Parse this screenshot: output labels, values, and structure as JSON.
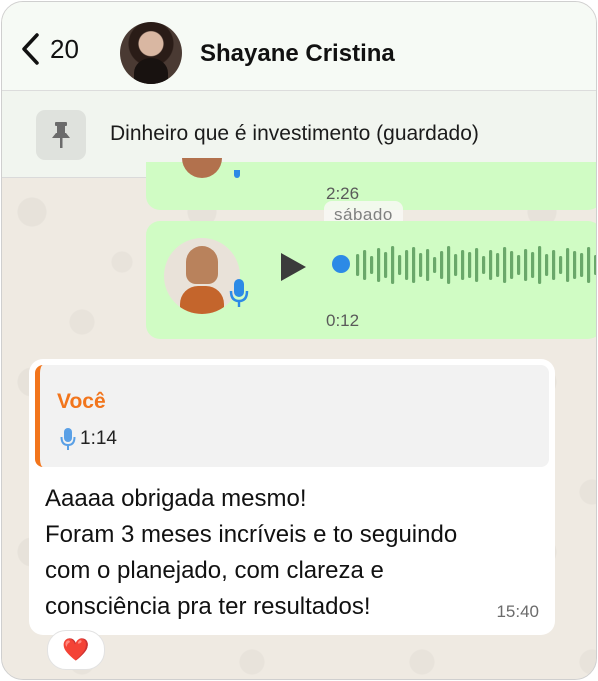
{
  "header": {
    "back_count": "20",
    "contact_name": "Shayane Cristina"
  },
  "pinned": {
    "text": "Dinheiro que é investimento (guardado)"
  },
  "messages": {
    "top_partial": {
      "time": "2:26"
    },
    "date_separator": "sábado",
    "voice_note": {
      "duration": "0:12"
    },
    "reply": {
      "quoted_author": "Você",
      "quoted_duration": "1:14",
      "text": "Aaaaa obrigada mesmo!\nForam 3 meses incríveis e to seguindo\ncom o planejado, com clareza e\nconsciência pra ter resultados!",
      "time": "15:40",
      "reaction": "❤️"
    }
  },
  "colors": {
    "outgoing_bubble": "#d0fcc4",
    "incoming_bubble": "#ffffff",
    "quote_accent": "#f2751c",
    "mic_blue": "#2c8ae6",
    "waveform": "#6aa86a"
  },
  "icons": {
    "back": "chevron-left-icon",
    "pin": "pin-icon",
    "play": "play-icon",
    "mic": "microphone-icon",
    "reaction": "heart-emoji"
  }
}
